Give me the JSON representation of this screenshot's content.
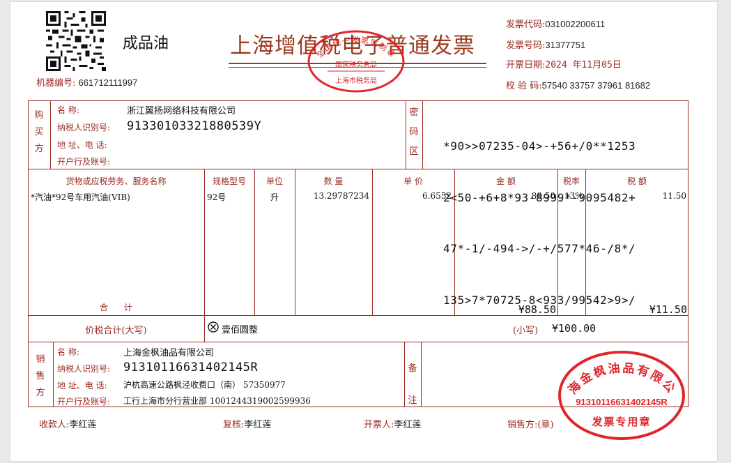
{
  "header": {
    "fuel_type": "成品油",
    "title": "上海增值税电子普通发票",
    "machine_label": "机器编号:",
    "machine_no": "661712111997",
    "invoice_code_label": "发票代码:",
    "invoice_code": "031002200611",
    "invoice_no_label": "发票号码:",
    "invoice_no": "31377751",
    "date_label": "开票日期:",
    "date": "2024 年11月05日",
    "check_label": "校 验 码:",
    "check_code": "57540 33757 37961 81682"
  },
  "tax_stamp": {
    "line1": "全国统一发票监制章",
    "line2": "国家税务总局",
    "line3": "上海市税务局"
  },
  "buyer": {
    "section": [
      "购",
      "买",
      "方"
    ],
    "name_label": "名      称:",
    "name": "浙江翼扬网络科技有限公司",
    "tax_id_label": "纳税人识别号:",
    "tax_id": "91330103321880539Y",
    "address_label": "地 址、电 话:",
    "address": "",
    "bank_label": "开户行及账号:",
    "bank": ""
  },
  "cipher": {
    "section": [
      "密",
      "码",
      "区"
    ],
    "lines": [
      "*90>>07235-04>-+56+/0**1253",
      "2<50-+6+8*93-8999*-9095482+",
      "47*-1/-494->/-+/577*46-/8*/",
      "135>7*70725-8<933/99542>9>/"
    ]
  },
  "items": {
    "headers": [
      "货物或应税劳务、服务名称",
      "规格型号",
      "单位",
      "数 量",
      "单 价",
      "金 额",
      "税率",
      "税 额"
    ],
    "rows": [
      [
        "*汽油*92号车用汽油(VIB)",
        "92号",
        "升",
        "13.29787234",
        "6.6552",
        "88.50",
        "13%",
        "11.50"
      ]
    ],
    "total_label": "合      计",
    "total_amount": "¥88.50",
    "total_tax": "¥11.50"
  },
  "sum": {
    "label": "价税合计(大写)",
    "upper": "壹佰圆整",
    "lower_label": "(小写)",
    "lower": "¥100.00"
  },
  "seller": {
    "section": [
      "销",
      "售",
      "方"
    ],
    "name_label": "名      称:",
    "name": "上海金枫油品有限公司",
    "tax_id_label": "纳税人识别号:",
    "tax_id": "91310116631402145R",
    "address_label": "地 址、电 话:",
    "address": "沪杭高速公路枫泾收费口（南） 57350977",
    "bank_label": "开户行及账号:",
    "bank": "工行上海市分行营业部 1001244319002599936"
  },
  "remarks": {
    "section": [
      "备",
      "注"
    ]
  },
  "seller_stamp": {
    "company": "上海金枫油品有限公司",
    "tax_id": "91310116631402145R",
    "type": "发票专用章"
  },
  "footer": {
    "payee_label": "收款人:",
    "payee": "李红莲",
    "reviewer_label": "复核:",
    "reviewer": "李红莲",
    "issuer_label": "开票人:",
    "issuer": "李红莲",
    "seller_label": "销售方:(章)"
  },
  "colors": {
    "frame": "#9b2a22",
    "stamp": "#e0262b",
    "title": "#9b3a1e"
  }
}
